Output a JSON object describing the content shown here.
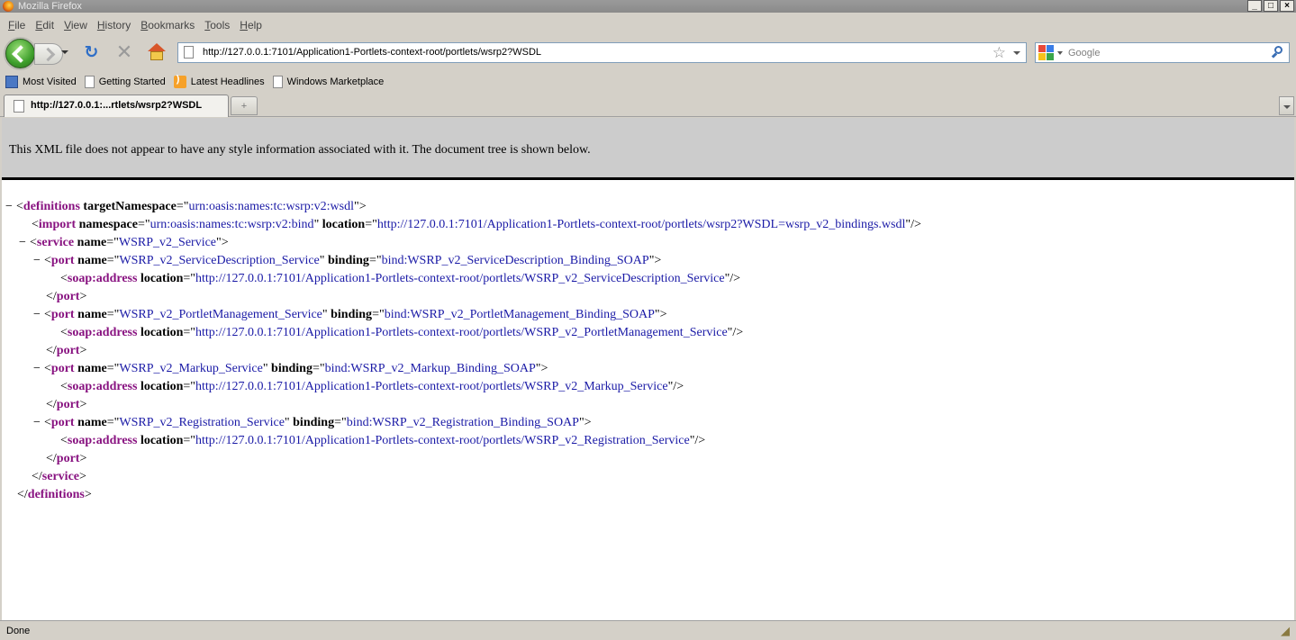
{
  "window": {
    "title": "Mozilla Firefox",
    "controls": [
      "_",
      "□",
      "×"
    ]
  },
  "menu": [
    {
      "label": "File",
      "accel": "F",
      "rest": "ile"
    },
    {
      "label": "Edit",
      "accel": "E",
      "rest": "dit"
    },
    {
      "label": "View",
      "accel": "V",
      "rest": "iew"
    },
    {
      "label": "History",
      "accel": "H",
      "rest": "istory"
    },
    {
      "label": "Bookmarks",
      "accel": "B",
      "rest": "ookmarks"
    },
    {
      "label": "Tools",
      "accel": "T",
      "rest": "ools"
    },
    {
      "label": "Help",
      "accel": "H",
      "rest": "elp"
    }
  ],
  "nav": {
    "url": "http://127.0.0.1:7101/Application1-Portlets-context-root/portlets/wsrp2?WSDL",
    "search_placeholder": "Google"
  },
  "bookmarks": [
    {
      "label": "Most Visited",
      "icon": "most-visited-icon"
    },
    {
      "label": "Getting Started",
      "icon": "page-icon"
    },
    {
      "label": "Latest Headlines",
      "icon": "rss-icon"
    },
    {
      "label": "Windows Marketplace",
      "icon": "page-icon"
    }
  ],
  "tab": {
    "label": "http://127.0.0.1:...rtlets/wsrp2?WSDL",
    "new_tab_symbol": "+"
  },
  "xml": {
    "header_message": "This XML file does not appear to have any style information associated with it. The document tree is shown below.",
    "lines": [
      {
        "toggle": "−",
        "parts": [
          [
            "p",
            "<"
          ],
          [
            "t",
            "definitions"
          ],
          [
            "p",
            " "
          ],
          [
            "a",
            "targetNamespace"
          ],
          [
            "p",
            "=\""
          ],
          [
            "v",
            "urn:oasis:names:tc:wsrp:v2:wsdl"
          ],
          [
            "p",
            "\">"
          ]
        ]
      },
      {
        "toggle": "",
        "parts": [
          [
            "p",
            "<"
          ],
          [
            "t",
            "import"
          ],
          [
            "p",
            " "
          ],
          [
            "a",
            "namespace"
          ],
          [
            "p",
            "=\""
          ],
          [
            "v",
            "urn:oasis:names:tc:wsrp:v2:bind"
          ],
          [
            "p",
            "\" "
          ],
          [
            "a",
            "location"
          ],
          [
            "p",
            "=\""
          ],
          [
            "v",
            "http://127.0.0.1:7101/Application1-Portlets-context-root/portlets/wsrp2?WSDL=wsrp_v2_bindings.wsdl"
          ],
          [
            "p",
            "\"/>"
          ]
        ]
      },
      {
        "toggle": "−",
        "parts": [
          [
            "p",
            "<"
          ],
          [
            "t",
            "service"
          ],
          [
            "p",
            " "
          ],
          [
            "a",
            "name"
          ],
          [
            "p",
            "=\""
          ],
          [
            "v",
            "WSRP_v2_Service"
          ],
          [
            "p",
            "\">"
          ]
        ]
      },
      {
        "toggle": "−",
        "parts": [
          [
            "p",
            "<"
          ],
          [
            "t",
            "port"
          ],
          [
            "p",
            " "
          ],
          [
            "a",
            "name"
          ],
          [
            "p",
            "=\""
          ],
          [
            "v",
            "WSRP_v2_ServiceDescription_Service"
          ],
          [
            "p",
            "\" "
          ],
          [
            "a",
            "binding"
          ],
          [
            "p",
            "=\""
          ],
          [
            "v",
            "bind:WSRP_v2_ServiceDescription_Binding_SOAP"
          ],
          [
            "p",
            "\">"
          ]
        ]
      },
      {
        "toggle": "",
        "parts": [
          [
            "p",
            "<"
          ],
          [
            "t",
            "soap:address"
          ],
          [
            "p",
            " "
          ],
          [
            "a",
            "location"
          ],
          [
            "p",
            "=\""
          ],
          [
            "v",
            "http://127.0.0.1:7101/Application1-Portlets-context-root/portlets/WSRP_v2_ServiceDescription_Service"
          ],
          [
            "p",
            "\"/>"
          ]
        ]
      },
      {
        "toggle": "",
        "parts": [
          [
            "p",
            "</"
          ],
          [
            "t",
            "port"
          ],
          [
            "p",
            ">"
          ]
        ]
      },
      {
        "toggle": "−",
        "parts": [
          [
            "p",
            "<"
          ],
          [
            "t",
            "port"
          ],
          [
            "p",
            " "
          ],
          [
            "a",
            "name"
          ],
          [
            "p",
            "=\""
          ],
          [
            "v",
            "WSRP_v2_PortletManagement_Service"
          ],
          [
            "p",
            "\" "
          ],
          [
            "a",
            "binding"
          ],
          [
            "p",
            "=\""
          ],
          [
            "v",
            "bind:WSRP_v2_PortletManagement_Binding_SOAP"
          ],
          [
            "p",
            "\">"
          ]
        ]
      },
      {
        "toggle": "",
        "parts": [
          [
            "p",
            "<"
          ],
          [
            "t",
            "soap:address"
          ],
          [
            "p",
            " "
          ],
          [
            "a",
            "location"
          ],
          [
            "p",
            "=\""
          ],
          [
            "v",
            "http://127.0.0.1:7101/Application1-Portlets-context-root/portlets/WSRP_v2_PortletManagement_Service"
          ],
          [
            "p",
            "\"/>"
          ]
        ]
      },
      {
        "toggle": "",
        "parts": [
          [
            "p",
            "</"
          ],
          [
            "t",
            "port"
          ],
          [
            "p",
            ">"
          ]
        ]
      },
      {
        "toggle": "−",
        "parts": [
          [
            "p",
            "<"
          ],
          [
            "t",
            "port"
          ],
          [
            "p",
            " "
          ],
          [
            "a",
            "name"
          ],
          [
            "p",
            "=\""
          ],
          [
            "v",
            "WSRP_v2_Markup_Service"
          ],
          [
            "p",
            "\" "
          ],
          [
            "a",
            "binding"
          ],
          [
            "p",
            "=\""
          ],
          [
            "v",
            "bind:WSRP_v2_Markup_Binding_SOAP"
          ],
          [
            "p",
            "\">"
          ]
        ]
      },
      {
        "toggle": "",
        "parts": [
          [
            "p",
            "<"
          ],
          [
            "t",
            "soap:address"
          ],
          [
            "p",
            " "
          ],
          [
            "a",
            "location"
          ],
          [
            "p",
            "=\""
          ],
          [
            "v",
            "http://127.0.0.1:7101/Application1-Portlets-context-root/portlets/WSRP_v2_Markup_Service"
          ],
          [
            "p",
            "\"/>"
          ]
        ]
      },
      {
        "toggle": "",
        "parts": [
          [
            "p",
            "</"
          ],
          [
            "t",
            "port"
          ],
          [
            "p",
            ">"
          ]
        ]
      },
      {
        "toggle": "−",
        "parts": [
          [
            "p",
            "<"
          ],
          [
            "t",
            "port"
          ],
          [
            "p",
            " "
          ],
          [
            "a",
            "name"
          ],
          [
            "p",
            "=\""
          ],
          [
            "v",
            "WSRP_v2_Registration_Service"
          ],
          [
            "p",
            "\" "
          ],
          [
            "a",
            "binding"
          ],
          [
            "p",
            "=\""
          ],
          [
            "v",
            "bind:WSRP_v2_Registration_Binding_SOAP"
          ],
          [
            "p",
            "\">"
          ]
        ]
      },
      {
        "toggle": "",
        "parts": [
          [
            "p",
            "<"
          ],
          [
            "t",
            "soap:address"
          ],
          [
            "p",
            " "
          ],
          [
            "a",
            "location"
          ],
          [
            "p",
            "=\""
          ],
          [
            "v",
            "http://127.0.0.1:7101/Application1-Portlets-context-root/portlets/WSRP_v2_Registration_Service"
          ],
          [
            "p",
            "\"/>"
          ]
        ]
      },
      {
        "toggle": "",
        "parts": [
          [
            "p",
            "</"
          ],
          [
            "t",
            "port"
          ],
          [
            "p",
            ">"
          ]
        ]
      },
      {
        "toggle": "",
        "parts": [
          [
            "p",
            "</"
          ],
          [
            "t",
            "service"
          ],
          [
            "p",
            ">"
          ]
        ]
      },
      {
        "toggle": "",
        "parts": [
          [
            "p",
            "</"
          ],
          [
            "t",
            "definitions"
          ],
          [
            "p",
            ">"
          ]
        ]
      }
    ]
  },
  "status": {
    "text": "Done"
  },
  "colors": {
    "tag": "#881280",
    "value": "#1a1aa6",
    "header_bg": "#cccccc",
    "chrome_bg": "#d4d0c8"
  }
}
